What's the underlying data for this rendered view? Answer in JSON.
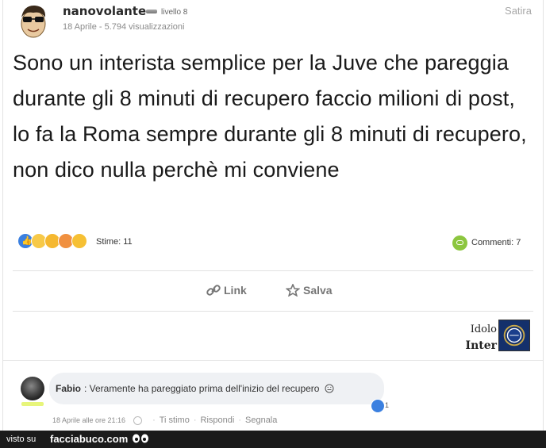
{
  "post": {
    "author": "nanovolante",
    "level": "livello 8",
    "meta": "18 Aprile - 5.794 visualizzazioni",
    "category": "Satira",
    "text": "Sono un interista semplice per la Juve che pareggia durante gli 8 minuti di recupero faccio milioni di post, lo fa la Roma sempre durante gli 8 minuti di recupero, non dico nulla perchè mi conviene",
    "likes_label": "Stime: 11",
    "comments_label": "Commenti: 7",
    "reactions": [
      "like-icon",
      "clap-icon",
      "laugh-icon",
      "love-icon",
      "wow-icon"
    ]
  },
  "actions": {
    "link_label": "Link",
    "save_label": "Salva"
  },
  "badge": {
    "line1": "Idolo",
    "line2": "Inter"
  },
  "comment": {
    "author": "Fabio",
    "text": ": Veramente ha pareggiato prima dell'inizio del recupero",
    "like_count": "1",
    "time": "18 Aprile alle ore 21:16",
    "like_label": "Ti stimo",
    "reply_label": "Rispondi",
    "report_label": "Segnala"
  },
  "footer": {
    "prefix": "visto su",
    "site": "facciabuco.com"
  },
  "colors": {
    "like_blue": "#3b80e0",
    "comments_green": "#8cc63f",
    "footer_bg": "#1b1b1b"
  }
}
